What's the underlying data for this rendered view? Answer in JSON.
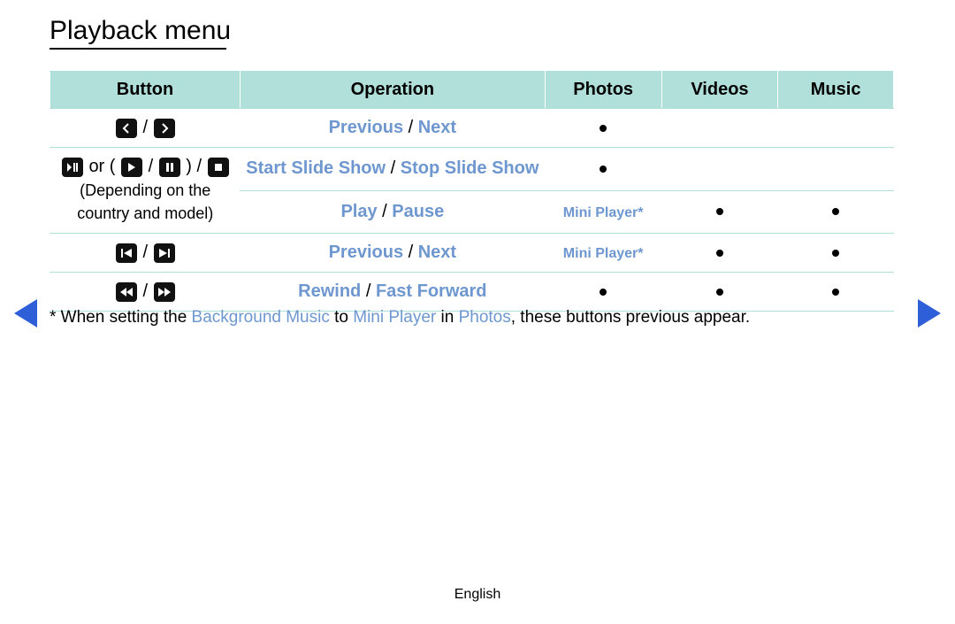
{
  "title": "Playback menu",
  "headers": {
    "button": "Button",
    "operation": "Operation",
    "photos": "Photos",
    "videos": "Videos",
    "music": "Music"
  },
  "rows": {
    "r1": {
      "op_a": "Previous",
      "op_b": "Next",
      "sep": " / ",
      "photos": "dot",
      "videos": "",
      "music": ""
    },
    "r2": {
      "or_text": " or ",
      "btn_note_line1": "(Depending on the",
      "btn_note_line2": "country and model)",
      "op_a": "Start Slide Show",
      "op_b": "Stop Slide Show",
      "sep": " / ",
      "photos": "dot",
      "videos": "",
      "music": ""
    },
    "r3": {
      "op_a": "Play",
      "op_b": "Pause",
      "sep": " / ",
      "photos_text": "Mini Player*",
      "videos": "dot",
      "music": "dot"
    },
    "r4": {
      "op_a": "Previous",
      "op_b": "Next",
      "sep": " / ",
      "photos_text": "Mini Player*",
      "videos": "dot",
      "music": "dot"
    },
    "r5": {
      "op_a": "Rewind",
      "op_b": "Fast Forward",
      "sep": " / ",
      "photos": "dot",
      "videos": "dot",
      "music": "dot"
    }
  },
  "footnote": {
    "prefix": "* When setting the ",
    "bg_music": "Background Music",
    "to": " to ",
    "mini": "Mini Player",
    "in": " in ",
    "photos": "Photos",
    "suffix": ", these buttons previous appear."
  },
  "footer": "English"
}
